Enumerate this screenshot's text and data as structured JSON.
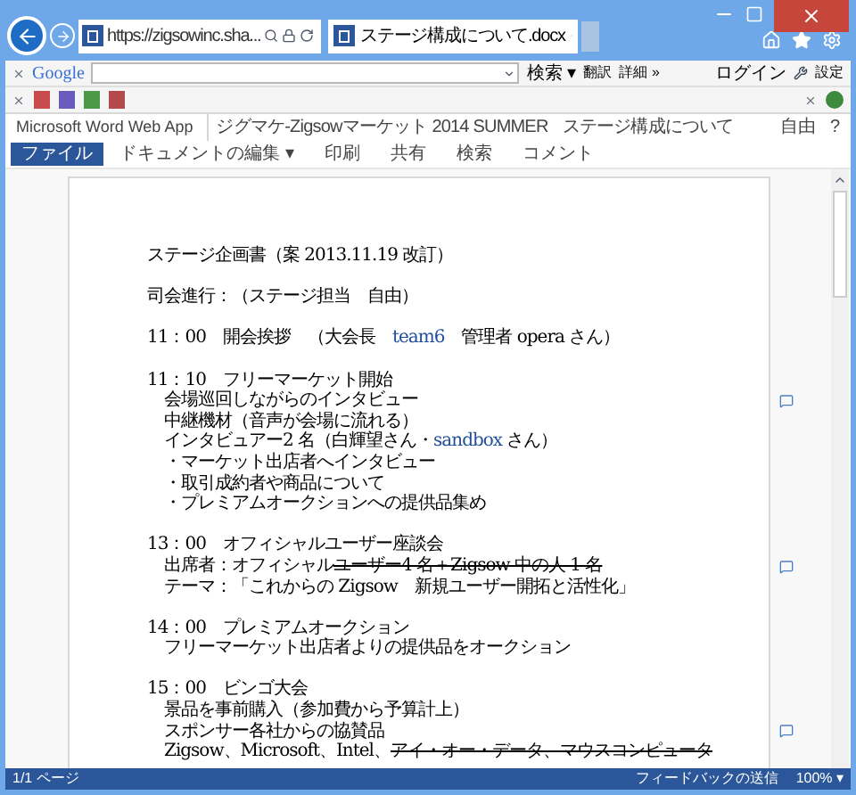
{
  "browser": {
    "address": "https://zigsowinc.sha...",
    "tab_title": "ステージ構成について.docx"
  },
  "google_toolbar": {
    "logo": "Google",
    "search_button": "検索 ▾",
    "translate_button": "翻訳",
    "more_button": "詳細 »",
    "login": "ログイン",
    "settings": "設定"
  },
  "word_header": {
    "app": "Microsoft Word Web App",
    "site": "ジグマケ-Zigsowマーケット 2014 SUMMER",
    "document": "ステージ構成について",
    "user": "自由",
    "help": "?"
  },
  "ribbon_tabs": [
    {
      "label": "ファイル",
      "selected": true
    },
    {
      "label": "ドキュメントの編集 ▾",
      "selected": false
    },
    {
      "label": "印刷",
      "selected": false
    },
    {
      "label": "共有",
      "selected": false
    },
    {
      "label": "検索",
      "selected": false
    },
    {
      "label": "コメント",
      "selected": false
    }
  ],
  "document": [
    {
      "lines": [
        {
          "segments": [
            {
              "text": "ステージ企画書（案 2013.11.19 改訂）",
              "kind": "plain"
            }
          ],
          "comment": false
        }
      ]
    },
    {
      "lines": [
        {
          "segments": [
            {
              "text": "司会進行：（ステージ担当　自由）",
              "kind": "plain"
            }
          ],
          "comment": false
        }
      ]
    },
    {
      "lines": [
        {
          "segments": [
            {
              "text": "11：00　開会挨拶　（大会長　",
              "kind": "plain"
            },
            {
              "text": "team6",
              "kind": "link"
            },
            {
              "text": "　管理者 opera さん）",
              "kind": "plain"
            }
          ],
          "comment": false
        }
      ]
    },
    {
      "lines": [
        {
          "segments": [
            {
              "text": "11：10　フリーマーケット開始",
              "kind": "plain"
            }
          ],
          "comment": false
        },
        {
          "segments": [
            {
              "text": "　会場巡回しながらのインタビュー",
              "kind": "plain"
            }
          ],
          "comment": true
        },
        {
          "segments": [
            {
              "text": "　中継機材（音声が会場に流れる）",
              "kind": "plain"
            }
          ],
          "comment": false
        },
        {
          "segments": [
            {
              "text": "　インタビュアー2 名（白輝望さん・",
              "kind": "plain"
            },
            {
              "text": "sandbox",
              "kind": "link"
            },
            {
              "text": " さん）",
              "kind": "plain"
            }
          ],
          "comment": false
        },
        {
          "segments": [
            {
              "text": "　・マーケット出店者へインタビュー",
              "kind": "plain"
            }
          ],
          "comment": false
        },
        {
          "segments": [
            {
              "text": "　・取引成約者や商品について",
              "kind": "plain"
            }
          ],
          "comment": false
        },
        {
          "segments": [
            {
              "text": "　・プレミアムオークションへの提供品集め",
              "kind": "plain"
            }
          ],
          "comment": false
        }
      ]
    },
    {
      "lines": [
        {
          "segments": [
            {
              "text": "13：00　オフィシャルユーザー座談会",
              "kind": "plain"
            }
          ],
          "comment": false
        },
        {
          "segments": [
            {
              "text": "　出席者：オフィシャル",
              "kind": "plain"
            },
            {
              "text": "ユーザー4 名＋Zigsow 中の人 1 名",
              "kind": "strike"
            }
          ],
          "comment": true
        },
        {
          "segments": [
            {
              "text": "　テーマ：「これからの Zigsow　新規ユーザー開拓と活性化」",
              "kind": "plain"
            }
          ],
          "comment": false
        }
      ]
    },
    {
      "lines": [
        {
          "segments": [
            {
              "text": "14：00　プレミアムオークション",
              "kind": "plain"
            }
          ],
          "comment": false
        },
        {
          "segments": [
            {
              "text": "　フリーマーケット出店者よりの提供品をオークション",
              "kind": "plain"
            }
          ],
          "comment": false
        }
      ]
    },
    {
      "lines": [
        {
          "segments": [
            {
              "text": "15：00　ビンゴ大会",
              "kind": "plain"
            }
          ],
          "comment": false
        },
        {
          "segments": [
            {
              "text": "　景品を事前購入（参加費から予算計上）",
              "kind": "plain"
            }
          ],
          "comment": false
        },
        {
          "segments": [
            {
              "text": "　スポンサー各社からの協賛品",
              "kind": "plain"
            }
          ],
          "comment": true
        },
        {
          "segments": [
            {
              "text": "　Zigsow、Microsoft、Intel、",
              "kind": "plain"
            },
            {
              "text": "アイ・オー・データ、マウスコンピュータ",
              "kind": "strike"
            }
          ],
          "comment": false
        }
      ]
    }
  ],
  "status_bar": {
    "page": "1/1 ページ",
    "feedback": "フィードバックの送信",
    "zoom": "100% ▾"
  }
}
